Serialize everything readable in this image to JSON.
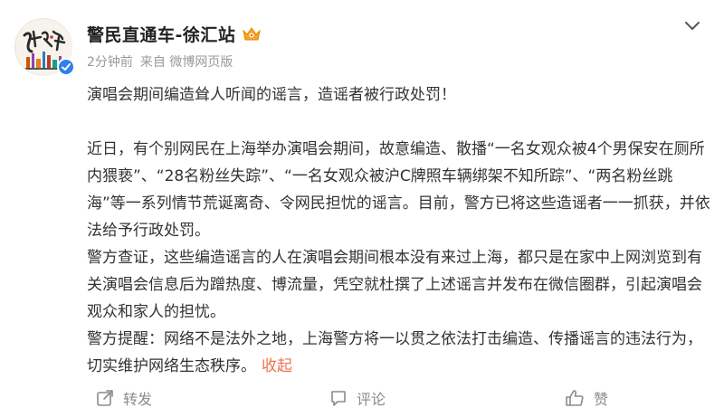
{
  "post": {
    "author": "警民直通车-徐汇站",
    "time": "2分钟前",
    "source": "来自 微博网页版",
    "headline": "演唱会期间编造耸人听闻的谣言，造谣者被行政处罚！",
    "paragraphs": [
      "近日，有个别网民在上海举办演唱会期间，故意编造、散播“一名女观众被4个男保安在厕所内猥亵”、“28名粉丝失踪”、“一名女观众被沪C牌照车辆绑架不知所踪”、“两名粉丝跳海”等一系列情节荒诞离奇、令网民担忧的谣言。目前，警方已将这些造谣者一一抓获，并依法给予行政处罚。",
      "警方查证，这些编造谣言的人在演唱会期间根本没有来过上海，都只是在家中上网浏览到有关演唱会信息后为蹭热度、博流量，凭空就杜撰了上述谣言并发布在微信圈群，引起演唱会观众和家人的担忧。",
      "警方提醒：网络不是法外之地，上海警方将一以贯之依法打击编造、传播谣言的违法行为，切实维护网络生态秩序。"
    ],
    "collapse_label": "收起"
  },
  "actions": {
    "repost_label": "转发",
    "comment_label": "评论",
    "like_label": "赞"
  },
  "icons": {
    "avatar": "xuhui-police-logo",
    "verified": "verified-badge-icon",
    "vip": "vip-crown-icon",
    "more": "chevron-down-icon",
    "repost": "repost-icon",
    "comment": "comment-icon",
    "like": "thumbs-up-icon"
  },
  "colors": {
    "accent": "#eb7350",
    "verified": "#2f80ed",
    "meta_text": "#999999",
    "action_text": "#8b8b8b"
  }
}
